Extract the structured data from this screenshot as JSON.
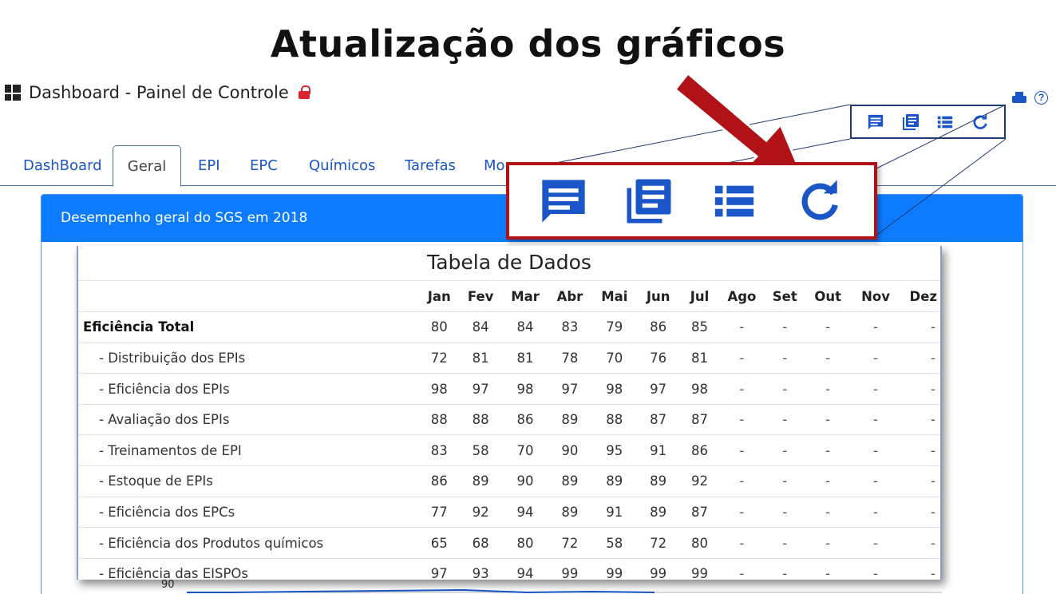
{
  "headline": "Atualização dos gráficos",
  "page_title": "Dashboard - Painel de Controle",
  "tabs": [
    {
      "label": "DashBoard"
    },
    {
      "label": "Geral"
    },
    {
      "label": "EPI"
    },
    {
      "label": "EPC"
    },
    {
      "label": "Químicos"
    },
    {
      "label": "Tarefas"
    },
    {
      "label": "Mo"
    }
  ],
  "panel_title": "Desempenho geral do SGS em 2018",
  "toolbar_icons": [
    "comment-icon",
    "document-icon",
    "list-icon",
    "refresh-icon"
  ],
  "table": {
    "title": "Tabela de Dados",
    "months": [
      "Jan",
      "Fev",
      "Mar",
      "Abr",
      "Mai",
      "Jun",
      "Jul",
      "Ago",
      "Set",
      "Out",
      "Nov",
      "Dez"
    ],
    "rows": [
      {
        "label": "Eficiência Total",
        "values": [
          "80",
          "84",
          "84",
          "83",
          "79",
          "86",
          "85",
          "-",
          "-",
          "-",
          "-",
          "-"
        ]
      },
      {
        "label": "- Distribuição dos EPIs",
        "values": [
          "72",
          "81",
          "81",
          "78",
          "70",
          "76",
          "81",
          "-",
          "-",
          "-",
          "-",
          "-"
        ]
      },
      {
        "label": "- Eficiência dos EPIs",
        "values": [
          "98",
          "97",
          "98",
          "97",
          "98",
          "97",
          "98",
          "-",
          "-",
          "-",
          "-",
          "-"
        ]
      },
      {
        "label": "- Avaliação dos EPIs",
        "values": [
          "88",
          "88",
          "86",
          "89",
          "88",
          "87",
          "87",
          "-",
          "-",
          "-",
          "-",
          "-"
        ]
      },
      {
        "label": "- Treinamentos de EPI",
        "values": [
          "83",
          "58",
          "70",
          "90",
          "95",
          "91",
          "86",
          "-",
          "-",
          "-",
          "-",
          "-"
        ]
      },
      {
        "label": "- Estoque de EPIs",
        "values": [
          "86",
          "89",
          "90",
          "89",
          "89",
          "89",
          "92",
          "-",
          "-",
          "-",
          "-",
          "-"
        ]
      },
      {
        "label": "- Eficiência dos EPCs",
        "values": [
          "77",
          "92",
          "94",
          "89",
          "91",
          "89",
          "87",
          "-",
          "-",
          "-",
          "-",
          "-"
        ]
      },
      {
        "label": "- Eficiência dos Produtos químicos",
        "values": [
          "65",
          "68",
          "80",
          "72",
          "58",
          "72",
          "80",
          "-",
          "-",
          "-",
          "-",
          "-"
        ]
      },
      {
        "label": "- Eficiência das EISPOs",
        "values": [
          "97",
          "93",
          "94",
          "99",
          "99",
          "99",
          "99",
          "-",
          "-",
          "-",
          "-",
          "-"
        ]
      }
    ]
  },
  "chart_peek_label": "90",
  "colors": {
    "accent": "#0d7bff",
    "link": "#1a56c7",
    "arrow": "#b01218",
    "lock": "#d9232e"
  }
}
